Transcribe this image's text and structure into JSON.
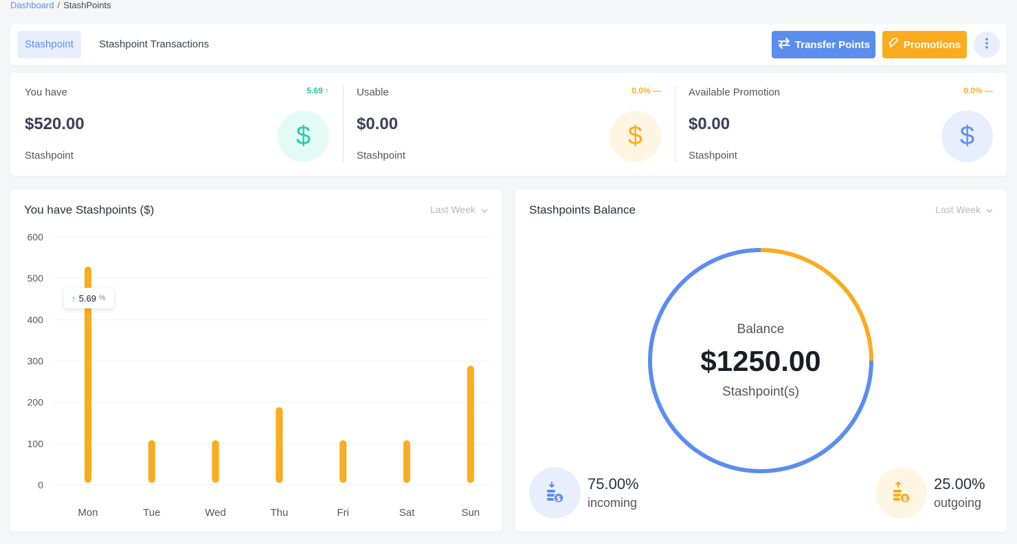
{
  "breadcrumb": {
    "root": "Dashboard",
    "current": "StashPoints"
  },
  "tabs": [
    {
      "label": "Stashpoint"
    },
    {
      "label": "Stashpoint Transactions"
    }
  ],
  "actions": {
    "transfer": "Transfer Points",
    "promotions": "Promotions"
  },
  "stats": [
    {
      "label": "You have",
      "value": "$520.00",
      "unit": "Stashpoint",
      "trend": "5.69",
      "trend_color": "#28c8a0",
      "icon_bg": "#e3faf5",
      "icon_color": "#2ec8a4"
    },
    {
      "label": "Usable",
      "value": "$0.00",
      "unit": "Stashpoint",
      "trend": "0.0%",
      "trend_color": "#fbab1f",
      "icon_bg": "#fff5e3",
      "icon_color": "#fbab1f"
    },
    {
      "label": "Available Promotion",
      "value": "$0.00",
      "unit": "Stashpoint",
      "trend": "0.0%",
      "trend_color": "#fbab1f",
      "icon_bg": "#e8eefc",
      "icon_color": "#5b8def"
    }
  ],
  "bar_chart": {
    "title": "You have Stashpoints ($)",
    "period": "Last Week",
    "tooltip": {
      "value": "5.69",
      "unit": "%"
    }
  },
  "donut": {
    "title": "Stashpoints Balance",
    "period": "Last Week",
    "center_label": "Balance",
    "center_value": "$1250.00",
    "center_unit": "Stashpoint(s)",
    "incoming": {
      "pct": "75.00%",
      "name": "incoming",
      "value": 75,
      "color": "#5b8def"
    },
    "outgoing": {
      "pct": "25.00%",
      "name": "outgoing",
      "value": 25,
      "color": "#fbab1f"
    }
  },
  "chart_data": [
    {
      "type": "bar",
      "categories": [
        "Mon",
        "Tue",
        "Wed",
        "Thu",
        "Fri",
        "Sat",
        "Sun"
      ],
      "values": [
        520,
        100,
        100,
        180,
        100,
        100,
        280
      ],
      "ylim": [
        0,
        600
      ],
      "yticks": [
        0,
        100,
        200,
        300,
        400,
        500,
        600
      ],
      "color": "#fbab1f",
      "grid": true
    },
    {
      "type": "pie",
      "categories": [
        "incoming",
        "outgoing"
      ],
      "values": [
        75,
        25
      ],
      "colors": [
        "#5b8def",
        "#fbab1f"
      ]
    }
  ]
}
